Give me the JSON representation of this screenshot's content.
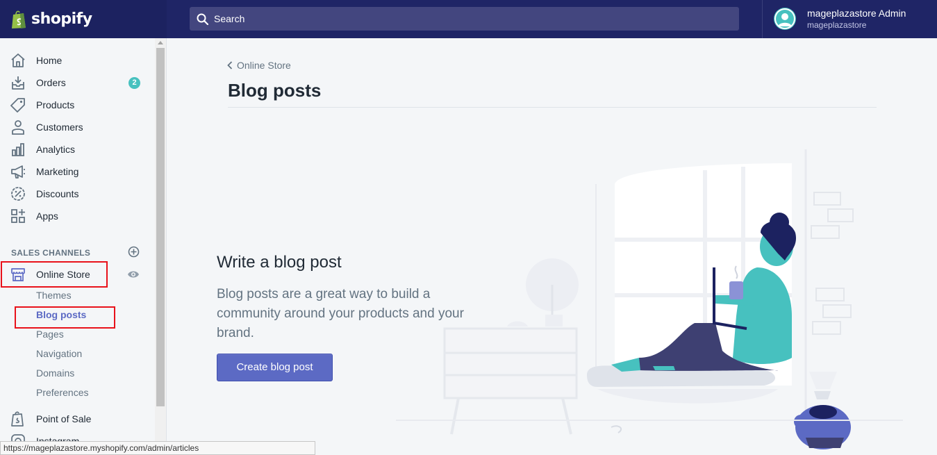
{
  "topbar": {
    "brand": "shopify",
    "search_placeholder": "Search",
    "user_name": "mageplazastore Admin",
    "user_store": "mageplazastore"
  },
  "sidebar": {
    "items": [
      {
        "label": "Home",
        "icon": "home-icon"
      },
      {
        "label": "Orders",
        "icon": "orders-icon",
        "badge": "2"
      },
      {
        "label": "Products",
        "icon": "tag-icon"
      },
      {
        "label": "Customers",
        "icon": "person-icon"
      },
      {
        "label": "Analytics",
        "icon": "bar-chart-icon"
      },
      {
        "label": "Marketing",
        "icon": "megaphone-icon"
      },
      {
        "label": "Discounts",
        "icon": "discount-icon"
      },
      {
        "label": "Apps",
        "icon": "apps-icon"
      }
    ],
    "sales_channels_heading": "SALES CHANNELS",
    "online_store": "Online Store",
    "sub_items": [
      "Themes",
      "Blog posts",
      "Pages",
      "Navigation",
      "Domains",
      "Preferences"
    ],
    "active_sub_item": "Blog posts",
    "point_of_sale": "Point of Sale",
    "instagram": "Instagram"
  },
  "main": {
    "breadcrumb": "Online Store",
    "page_title": "Blog posts",
    "empty_state_title": "Write a blog post",
    "empty_state_body": "Blog posts are a great way to build a community around your products and your brand.",
    "cta_label": "Create blog post"
  },
  "statusbar": {
    "url": "https://mageplazastore.myshopify.com/admin/articles"
  },
  "colors": {
    "topbar": "#1c2260",
    "search": "#43467f",
    "accent": "#5c6ac4",
    "badge": "#47c1bf",
    "highlight": "#e8111a"
  }
}
